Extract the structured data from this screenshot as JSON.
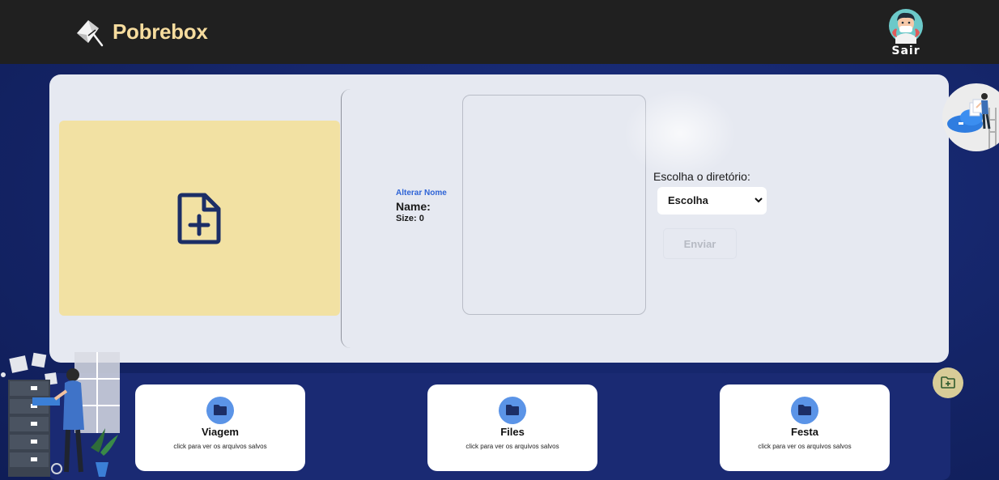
{
  "app": {
    "brand": "Pobrebox"
  },
  "header": {
    "logout_label": "Sair"
  },
  "upload": {
    "rename_label": "Alterar Nome",
    "name_label": "Name:",
    "size_label": "Size: 0",
    "directory_label": "Escolha o diretório:",
    "directory_selected": "Escolha",
    "send_label": "Enviar"
  },
  "folders": [
    {
      "name": "Viagem",
      "hint": "click para ver os arquivos salvos"
    },
    {
      "name": "Files",
      "hint": "click para ver os arquivos salvos"
    },
    {
      "name": "Festa",
      "hint": "click para ver os arquivos salvos"
    }
  ],
  "colors": {
    "header_bg": "#202020",
    "brand": "#f6dc9e",
    "page_bg": "#16286e",
    "card_bg": "#e6e9f1",
    "dropzone_bg": "#f2e1a3",
    "accent_link": "#2f64d6",
    "folder_icon": "#5b94e7",
    "icon_dark": "#1c2e66"
  },
  "icons": {
    "logo": "paper-plane-box-icon",
    "dropzone": "file-plus-icon",
    "folder": "folder-icon",
    "new_folder": "folder-plus-icon",
    "select": "chevron-down-icon"
  }
}
